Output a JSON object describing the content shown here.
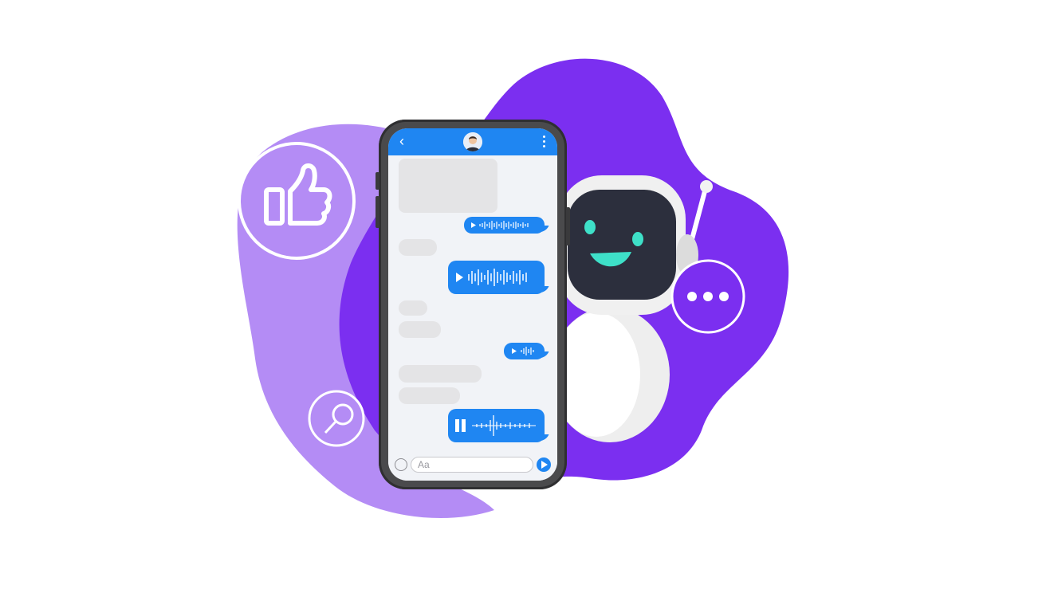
{
  "colors": {
    "purple_dark": "#7b2ff0",
    "purple_light": "#b48cf5",
    "accent_blue": "#1f86f2",
    "robot_face_screen": "#2c2f3d",
    "robot_eyes": "#3ee0c8"
  },
  "icons": {
    "thumbs_up": "thumbs-up-icon",
    "search": "search-icon",
    "typing": "more-horizontal-icon",
    "back": "chevron-left-icon",
    "menu": "more-vertical-icon",
    "emoji": "smile-icon",
    "send": "send-icon",
    "play": "play-icon",
    "pause": "pause-icon"
  },
  "chat": {
    "back_glyph": "‹",
    "input_placeholder": "Aa"
  }
}
